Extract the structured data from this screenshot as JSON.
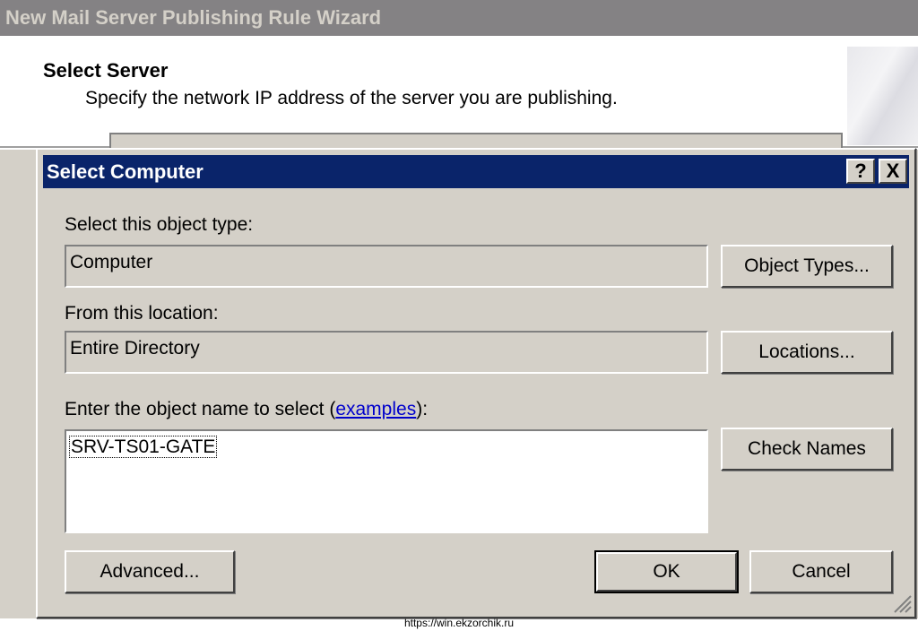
{
  "wizard": {
    "title": "New Mail Server Publishing Rule Wizard",
    "heading": "Select Server",
    "subheading": "Specify the network IP address of the server you are publishing."
  },
  "dialog": {
    "title": "Select Computer",
    "help_label": "?",
    "close_label": "X",
    "object_type_label": "Select this object type:",
    "object_type_value": "Computer",
    "object_types_button": "Object Types...",
    "location_label": "From this location:",
    "location_value": "Entire Directory",
    "locations_button": "Locations...",
    "name_label_prefix": "Enter the object name to select (",
    "name_label_link": "examples",
    "name_label_suffix": "):",
    "name_value": "SRV-TS01-GATE",
    "check_names_button": "Check Names",
    "advanced_button": "Advanced...",
    "ok_button": "OK",
    "cancel_button": "Cancel"
  },
  "watermark": "https://win.ekzorchik.ru",
  "colors": {
    "title_bar": "#0a246a",
    "dialog_bg": "#d4d0c8",
    "inactive_title": "#848284"
  }
}
